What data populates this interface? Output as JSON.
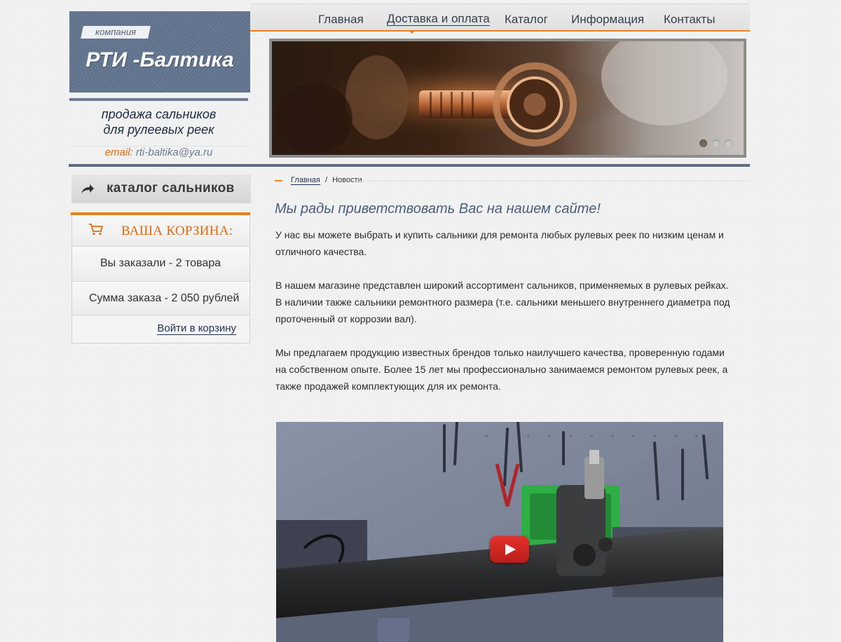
{
  "logo": {
    "tag": "компания",
    "title": "РТИ -Балтика",
    "tagline_line1": "продажа сальников",
    "tagline_line2": "для рулеевых реек",
    "email_label": "email:",
    "email": "rti-baltika@ya.ru"
  },
  "nav": {
    "items": [
      {
        "label": "Главная"
      },
      {
        "label": "Доставка и оплата"
      },
      {
        "label": "Каталог"
      },
      {
        "label": "Информация"
      },
      {
        "label": "Контакты"
      }
    ],
    "active_index": 1
  },
  "slider": {
    "slide_count": 3,
    "active_slide": 1
  },
  "sidebar": {
    "catalog_label": "каталог сальников",
    "cart": {
      "title": "ВАША КОРЗИНА:",
      "ordered": "Вы заказали - 2 товара",
      "total": "Сумма заказа - 2 050 рублей",
      "link": "Войти в корзину"
    }
  },
  "breadcrumb": {
    "home": "Главная",
    "separator": "/",
    "current": "Новости"
  },
  "main": {
    "title": "Мы рады приветствовать Вас на нашем сайте!",
    "paragraphs": [
      "У нас вы можете выбрать и купить сальники для ремонта любых рулевых реек по низким ценам и отличного качества.",
      "В нашем магазине представлен широкий ассортимент сальников, применяемых в рулевых рейках. В наличии также сальники ремонтного размера (т.е. сальники меньшего внутреннего диаметра под проточенный от коррозии вал).",
      "Мы предлагаем продукцию известных брендов только наилучшего качества, проверенную годами на собственном опыте. Более 15 лет мы профессионально занимаемся ремонтом рулевых реек, а также продажей комплектующих для их ремонта."
    ]
  },
  "colors": {
    "accent": "#ef7f1a",
    "logo_bg": "#63758f",
    "heading": "#4a5e7c",
    "link": "#1f3453"
  },
  "icons": {
    "catalog": "arrow-right-icon",
    "cart": "shopping-cart-icon",
    "video": "play-icon"
  }
}
